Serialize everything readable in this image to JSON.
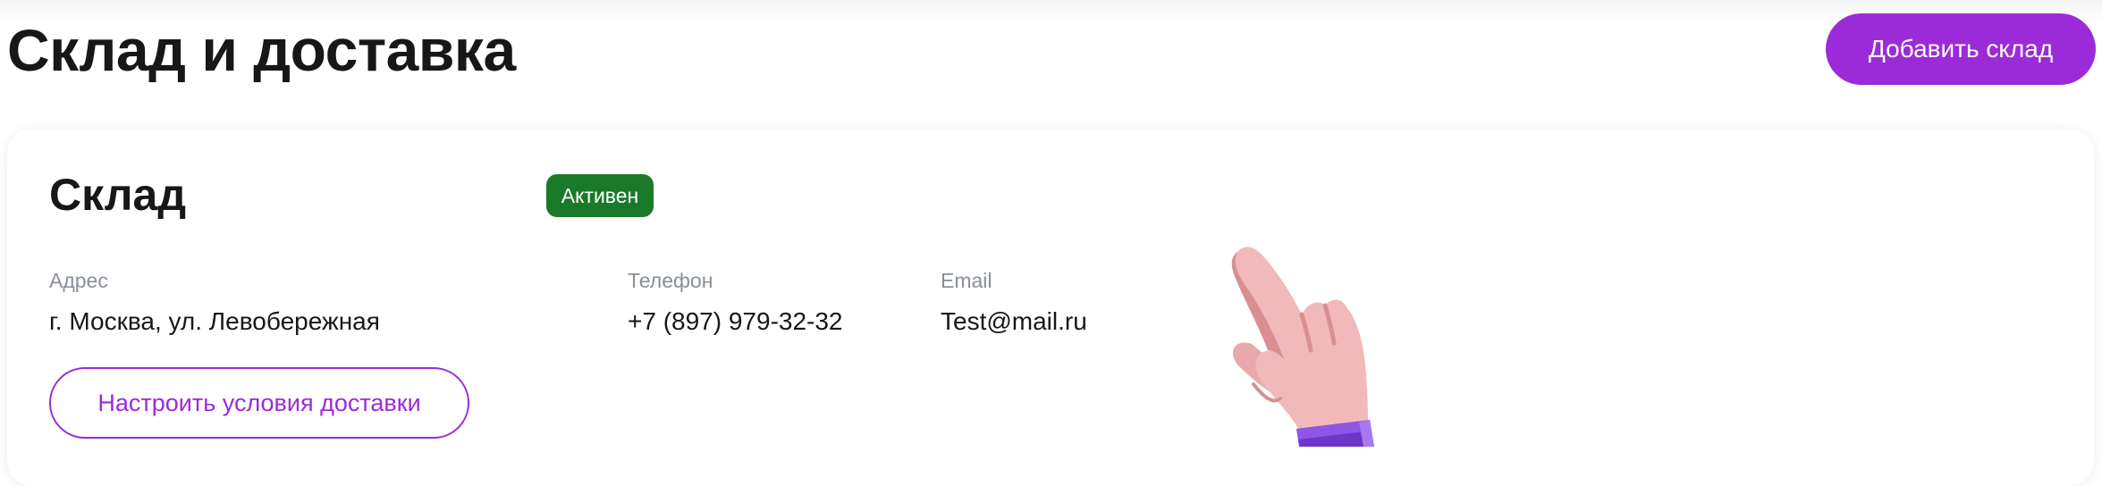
{
  "header": {
    "title": "Склад и доставка",
    "add_button_label": "Добавить склад"
  },
  "warehouse_card": {
    "title": "Склад",
    "status": "Активен",
    "fields": {
      "address": {
        "label": "Адрес",
        "value": "г. Москва, ул. Левобережная"
      },
      "phone": {
        "label": "Телефон",
        "value": "+7 (897) 979-32-32"
      },
      "email": {
        "label": "Email",
        "value": "Test@mail.ru"
      }
    },
    "delivery_button_label": "Настроить условия доставки"
  },
  "icons": {
    "pointer": "pointing-hand-icon"
  },
  "colors": {
    "accent": "#9b2bd9",
    "status_active": "#1b7a2a",
    "label_gray": "#8a8f98",
    "text_dark": "#17171a"
  }
}
